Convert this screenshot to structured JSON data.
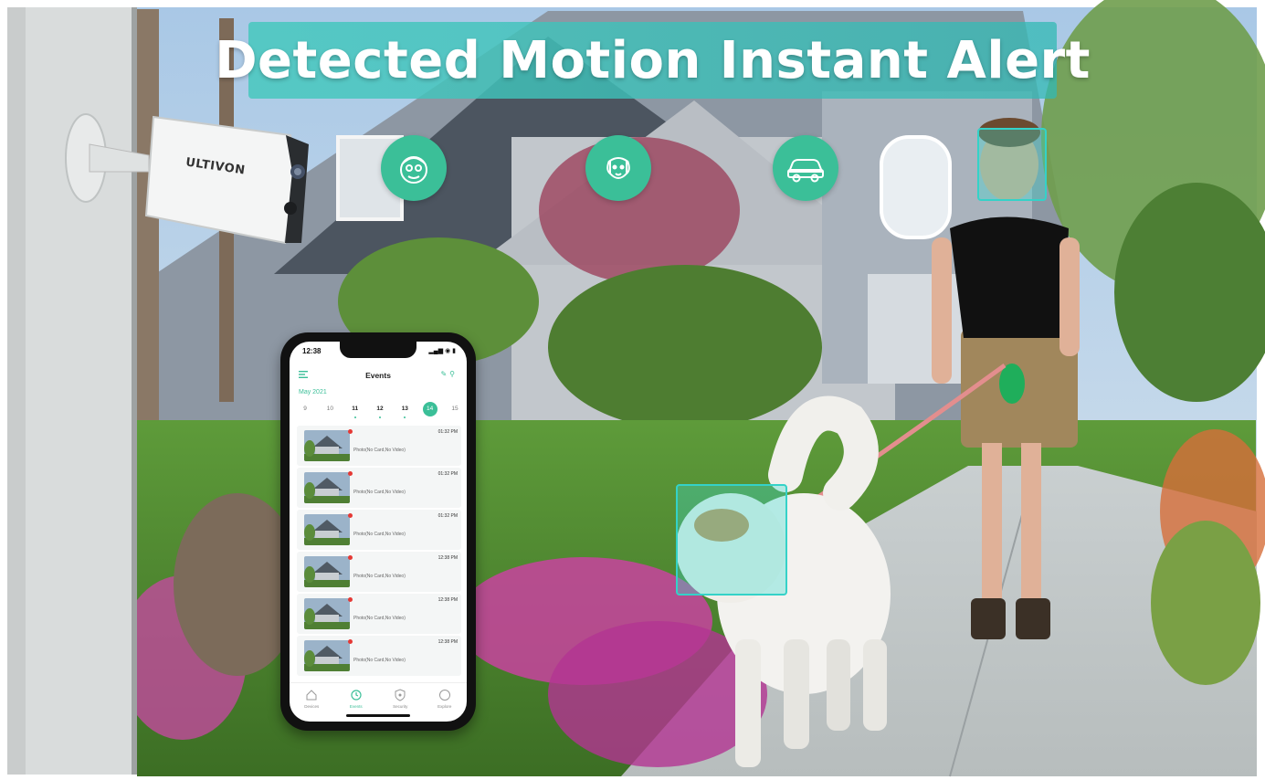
{
  "banner": {
    "title": "Detected Motion  Instant Alert"
  },
  "categories": [
    {
      "icon": "person-icon"
    },
    {
      "icon": "pet-icon"
    },
    {
      "icon": "car-icon"
    }
  ],
  "camera": {
    "brand": "ULTIVON"
  },
  "phone": {
    "status_time": "12:38",
    "status_icons": "▂▄▆ ◉ ▮",
    "title": "Events",
    "month": "May 2021",
    "dates": [
      {
        "day": "9",
        "style": "normal"
      },
      {
        "day": "10",
        "style": "normal"
      },
      {
        "day": "11",
        "style": "bold"
      },
      {
        "day": "12",
        "style": "bold"
      },
      {
        "day": "13",
        "style": "bold"
      },
      {
        "day": "14",
        "style": "active"
      },
      {
        "day": "15",
        "style": "normal"
      }
    ],
    "events": [
      {
        "time": "01:32 PM",
        "label": "Photo(No Card,No Video)"
      },
      {
        "time": "01:32 PM",
        "label": "Photo(No Card,No Video)"
      },
      {
        "time": "01:32 PM",
        "label": "Photo(No Card,No Video)"
      },
      {
        "time": "12:38 PM",
        "label": "Photo(No Card,No Video)"
      },
      {
        "time": "12:38 PM",
        "label": "Photo(No Card,No Video)"
      },
      {
        "time": "12:38 PM",
        "label": "Photo(No Card,No Video)"
      }
    ],
    "tabs": [
      {
        "label": "Devices",
        "icon": "home-icon",
        "active": false
      },
      {
        "label": "Events",
        "icon": "events-icon",
        "active": true
      },
      {
        "label": "Security",
        "icon": "shield-icon",
        "active": false
      },
      {
        "label": "Explore",
        "icon": "compass-icon",
        "active": false
      }
    ]
  },
  "colors": {
    "accent": "#3bbf98",
    "banner": "#46c8be",
    "detect": "#34d2c8"
  }
}
